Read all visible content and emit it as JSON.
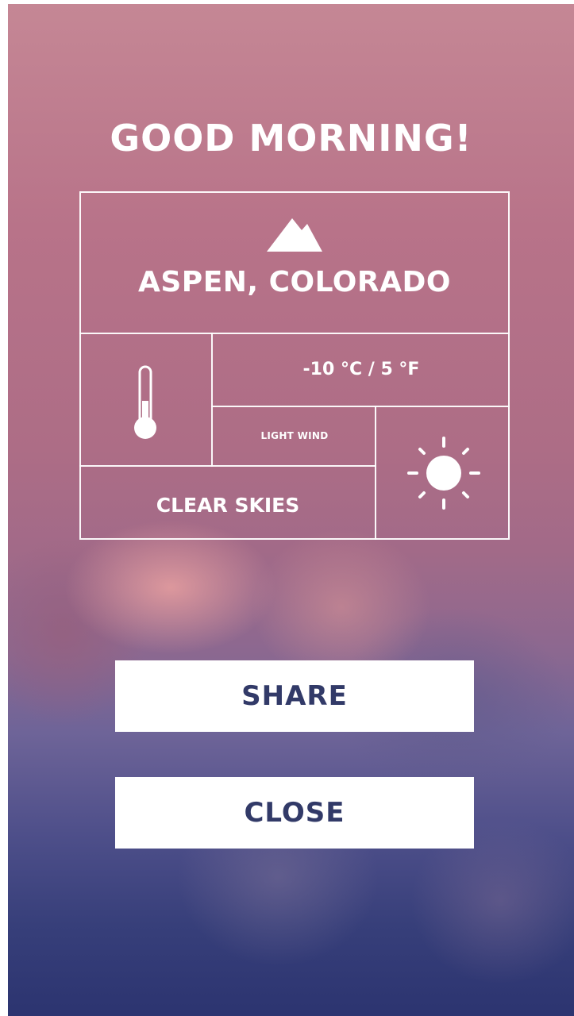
{
  "greeting": "GOOD MORNING!",
  "weather": {
    "location": "ASPEN, COLORADO",
    "temperature": "-10 °C / 5 °F",
    "wind": "LIGHT WIND",
    "sky": "CLEAR SKIES",
    "icons": {
      "location": "mountain-icon",
      "temperature": "thermometer-icon",
      "condition": "sun-icon"
    }
  },
  "actions": {
    "share_label": "SHARE",
    "close_label": "CLOSE"
  },
  "colors": {
    "background_top": "#c58795",
    "background_bottom": "#2c3470",
    "button_text": "#323a68",
    "foreground": "#ffffff"
  }
}
